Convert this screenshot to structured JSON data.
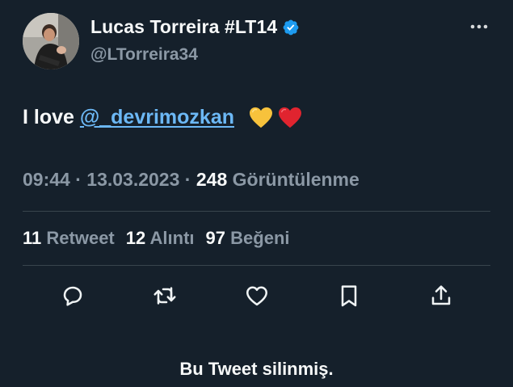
{
  "tweet": {
    "author": {
      "display_name": "Lucas Torreira #LT14",
      "handle": "@LTorreira34",
      "verified": true,
      "avatar_icon": "profile-photo"
    },
    "text_prefix": "I love ",
    "mention": "@_devrimozkan",
    "emojis": [
      "yellow-heart",
      "red-heart"
    ],
    "time": "09:44",
    "separator": "·",
    "date": "13.03.2023",
    "views_count": "248",
    "views_label": "Görüntülenme",
    "stats": {
      "retweets": {
        "count": "11",
        "label": "Retweet"
      },
      "quotes": {
        "count": "12",
        "label": "Alıntı"
      },
      "likes": {
        "count": "97",
        "label": "Beğeni"
      }
    },
    "actions": [
      "reply-icon",
      "retweet-icon",
      "like-icon",
      "bookmark-icon",
      "share-icon"
    ]
  },
  "footer": {
    "deleted_notice": "Bu Tweet silinmiş."
  },
  "colors": {
    "background": "#15202b",
    "text_primary": "#f7f9f9",
    "text_secondary": "#8b98a5",
    "link": "#6cb8f5",
    "verified": "#1d9bf0",
    "divider": "#38444d"
  }
}
